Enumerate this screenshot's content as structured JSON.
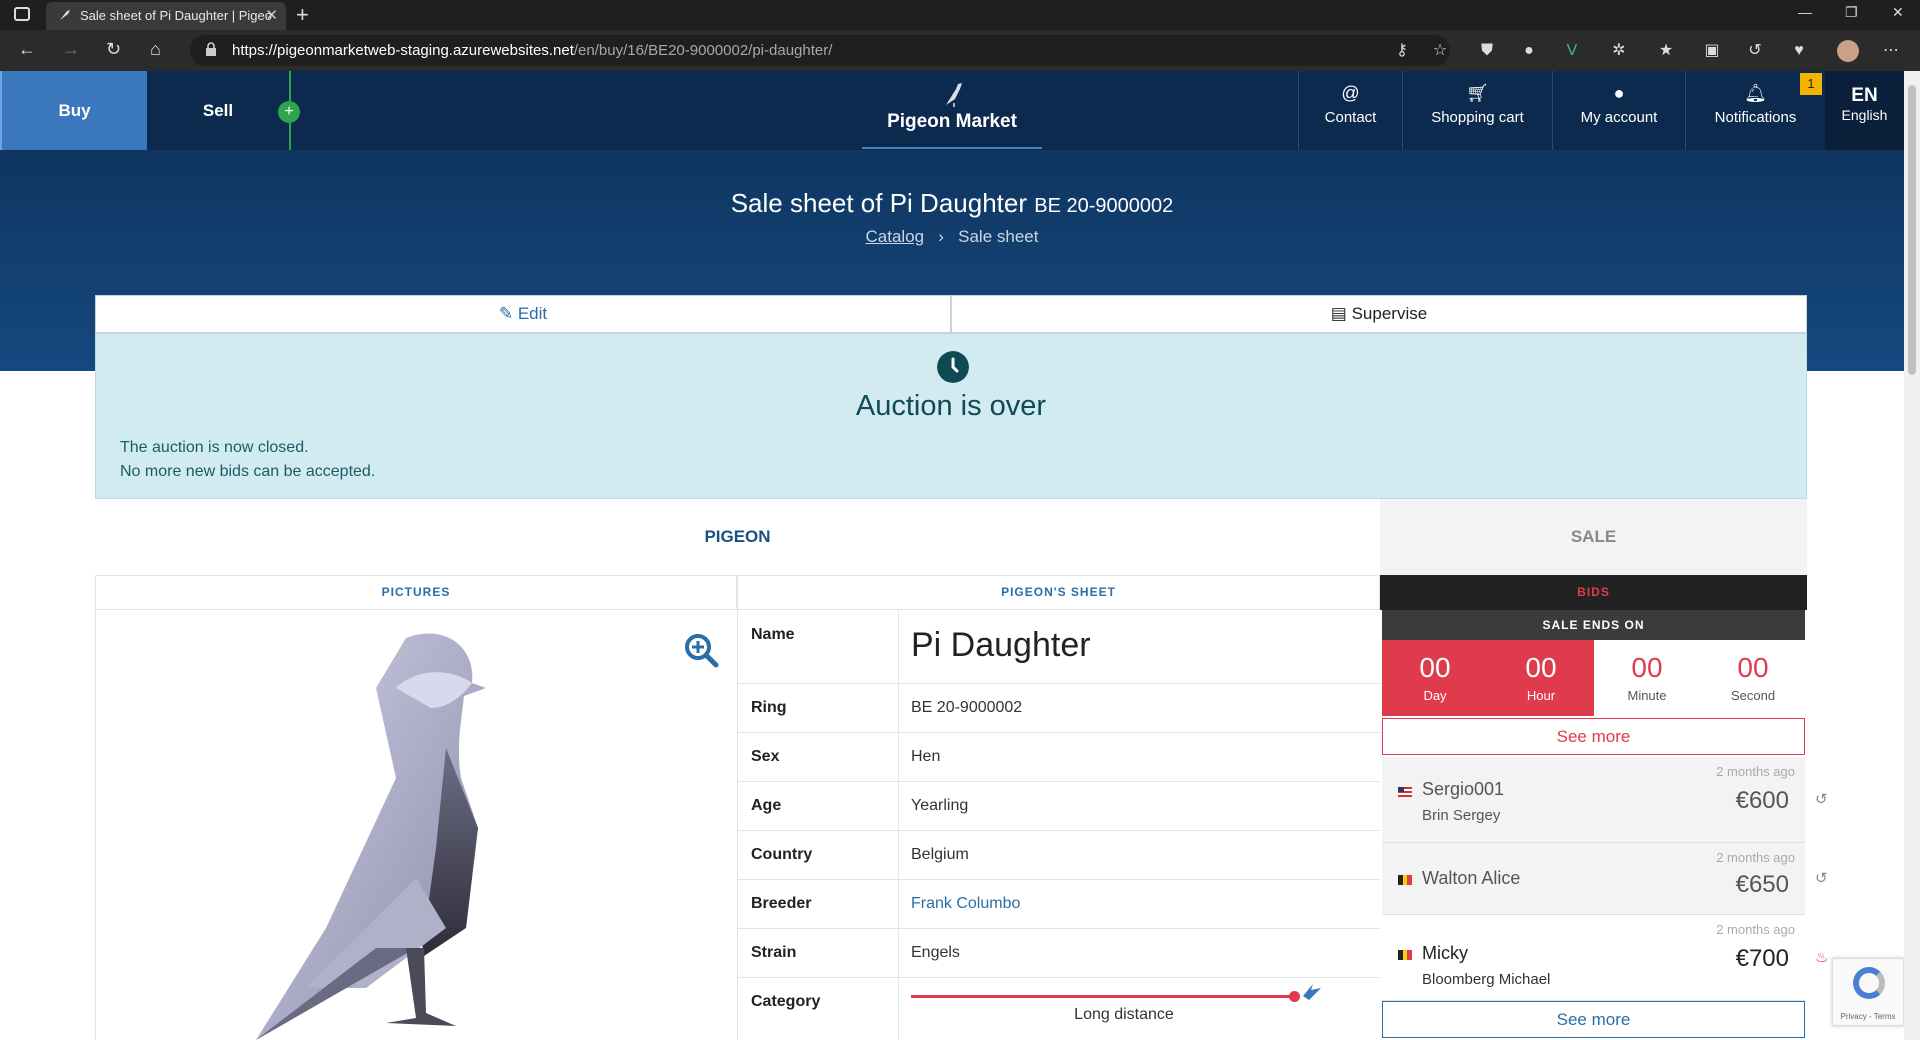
{
  "browser": {
    "tab_title": "Sale sheet of Pi Daughter | Pigeo",
    "url_host": "https://pigeonmarketweb-staging.azurewebsites.net",
    "url_path": "/en/buy/16/BE20-9000002/pi-daughter/"
  },
  "nav": {
    "buy": "Buy",
    "sell": "Sell",
    "plus": "+",
    "brand": "Pigeon Market",
    "contact": "Contact",
    "cart": "Shopping cart",
    "account": "My account",
    "notifications": "Notifications",
    "notif_count": "1",
    "lang_code": "EN",
    "lang_label": "English"
  },
  "page": {
    "title": "Sale sheet of Pi Daughter",
    "ring": "BE 20-9000002",
    "breadcrumb_catalog": "Catalog",
    "breadcrumb_current": "Sale sheet"
  },
  "actions": {
    "edit": "Edit",
    "supervise": "Supervise"
  },
  "alert": {
    "heading": "Auction is over",
    "line1": "The auction is now closed.",
    "line2": "No more new bids can be accepted."
  },
  "tabs": {
    "pigeon": "PIGEON",
    "sale": "SALE"
  },
  "subheads": {
    "pictures": "PICTURES",
    "sheet": "PIGEON'S SHEET",
    "bids": "BIDS"
  },
  "sheet": [
    {
      "label": "Name",
      "value": "Pi Daughter"
    },
    {
      "label": "Ring",
      "value": "BE 20-9000002"
    },
    {
      "label": "Sex",
      "value": "Hen"
    },
    {
      "label": "Age",
      "value": "Yearling"
    },
    {
      "label": "Country",
      "value": "Belgium"
    },
    {
      "label": "Breeder",
      "value": "Frank Columbo"
    },
    {
      "label": "Strain",
      "value": "Engels"
    },
    {
      "label": "Category",
      "value": "Long distance"
    }
  ],
  "sale": {
    "ends_on": "SALE ENDS ON",
    "countdown": [
      {
        "n": "00",
        "u": "Day"
      },
      {
        "n": "00",
        "u": "Hour"
      },
      {
        "n": "00",
        "u": "Minute"
      },
      {
        "n": "00",
        "u": "Second"
      }
    ],
    "see_more": "See more",
    "see_more_bottom": "See more",
    "bids": [
      {
        "time": "2 months ago",
        "user": "Sergio001",
        "name": "Brin Sergey",
        "amount": "€600"
      },
      {
        "time": "2 months ago",
        "user": "Walton Alice",
        "name": "",
        "amount": "€650"
      },
      {
        "time": "2 months ago",
        "user": "Micky",
        "name": "Bloomberg Michael",
        "amount": "€700"
      }
    ]
  },
  "captcha": {
    "text": "Privacy - Terms"
  },
  "colors": {
    "navy": "#0c2a4d",
    "accent": "#3a77bd",
    "danger": "#e03b4c",
    "alert_bg": "#d2ebf1"
  }
}
